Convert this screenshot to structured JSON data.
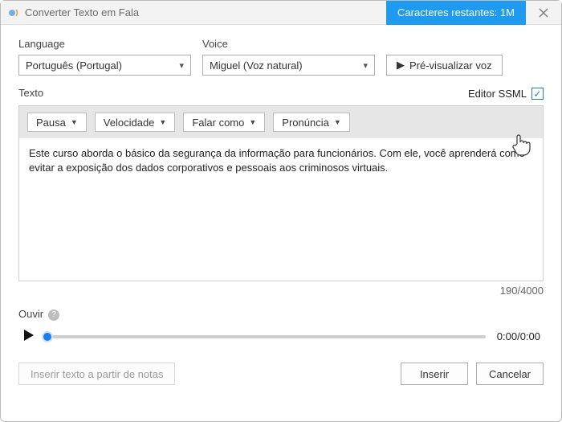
{
  "title": "Converter Texto em Fala",
  "chars_remaining": "Caracteres restantes: 1M",
  "labels": {
    "language": "Language",
    "voice": "Voice",
    "texto": "Texto",
    "ssml": "Editor SSML",
    "ouvir": "Ouvir"
  },
  "selects": {
    "language_value": "Português (Portugal)",
    "voice_value": "Miguel (Voz natural)"
  },
  "buttons": {
    "preview": "Pré-visualizar voz",
    "insert_notes": "Inserir texto a partir de notas",
    "insert": "Inserir",
    "cancel": "Cancelar"
  },
  "toolbar": {
    "pause": "Pausa",
    "speed": "Velocidade",
    "speak_as": "Falar como",
    "pronunciation": "Pronúncia"
  },
  "text_content": "Este curso aborda o básico da segurança da informação para funcionários. Com ele, você aprenderá como evitar a exposição dos dados corporativos e pessoais aos criminosos virtuais.",
  "counter": "190/4000",
  "player": {
    "time": "0:00/0:00"
  }
}
